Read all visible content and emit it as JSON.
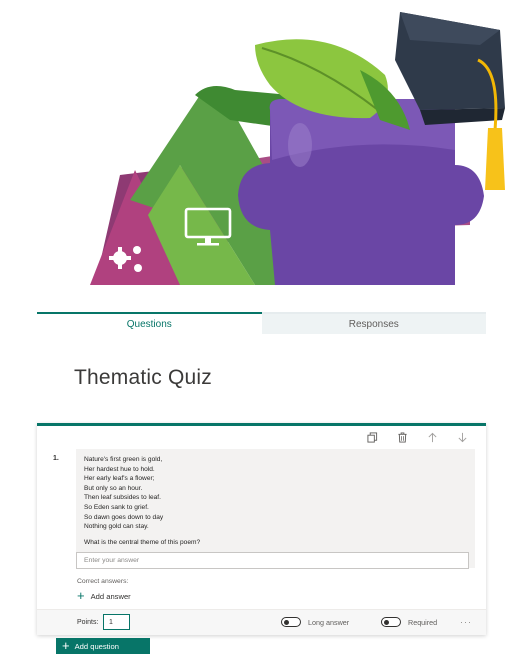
{
  "hero": {
    "icons": [
      "gears-icon",
      "monitor-icon",
      "puzzle-icon",
      "leaf-icon",
      "graduation-cap-icon"
    ]
  },
  "tabs": [
    {
      "label": "Questions",
      "active": true
    },
    {
      "label": "Responses",
      "active": false
    }
  ],
  "quiz": {
    "title": "Thematic Quiz"
  },
  "question": {
    "number": "1.",
    "poem_lines": [
      "Nature's first green is gold,",
      "Her hardest hue to hold.",
      "Her early leaf's a flower;",
      "But only so an hour.",
      "Then leaf subsides to leaf.",
      "So Eden sank to grief.",
      "So dawn goes down to day",
      "Nothing gold can stay."
    ],
    "prompt": "What is the central theme of this poem?",
    "answer_placeholder": "Enter your answer",
    "correct_answers_label": "Correct answers:",
    "add_answer_label": "Add answer",
    "points_label": "Points:",
    "points_value": "1",
    "long_answer_label": "Long answer",
    "required_label": "Required",
    "more_label": "···",
    "toolbar_icons": [
      "copy-icon",
      "delete-icon",
      "move-up-icon",
      "move-down-icon"
    ]
  },
  "actions": {
    "add_question_label": "Add question"
  },
  "colors": {
    "accent": "#077568",
    "tab_inactive_bg": "#eef3f4"
  }
}
